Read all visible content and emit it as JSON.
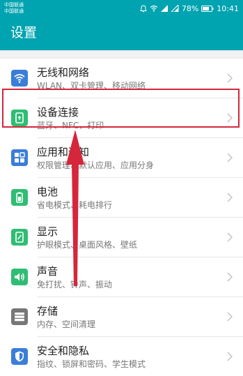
{
  "status_bar": {
    "carrier1": "中国联通",
    "carrier2": "中国联通",
    "battery": "78%",
    "time": "10:41"
  },
  "header": {
    "title": "设置"
  },
  "colors": {
    "header_bg": "#00a3b0",
    "highlight": "#d5263b"
  },
  "settings": [
    {
      "label": "无线和网络",
      "sub": "WLAN、双卡管理、移动网络",
      "icon": "wifi-icon",
      "color": "#3a7ed8"
    },
    {
      "label": "设备连接",
      "sub": "蓝牙、NFC、打印",
      "icon": "device-connection-icon",
      "color": "#2fbd74"
    },
    {
      "label": "应用和通知",
      "sub": "权限管理、默认应用、应用分身",
      "icon": "apps-grid-icon",
      "color": "#3a7ed8"
    },
    {
      "label": "电池",
      "sub": "省电模式、耗电排行",
      "icon": "battery-icon",
      "color": "#2fbd74"
    },
    {
      "label": "显示",
      "sub": "护眼模式、桌面风格、壁纸",
      "icon": "display-icon",
      "color": "#2fbd74"
    },
    {
      "label": "声音",
      "sub": "免打扰、铃声、振动",
      "icon": "sound-icon",
      "color": "#2fbd74"
    },
    {
      "label": "存储",
      "sub": "内存、空间清理",
      "icon": "storage-icon",
      "color": "#777777"
    },
    {
      "label": "安全和隐私",
      "sub": "指纹、锁屏和密码、学生模式",
      "icon": "shield-icon",
      "color": "#3a7ed8"
    }
  ]
}
